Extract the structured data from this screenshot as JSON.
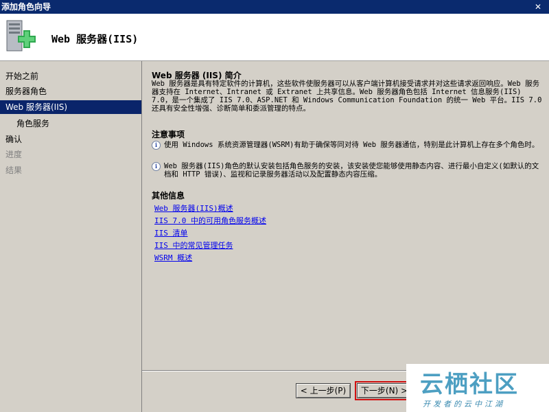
{
  "window": {
    "title": "添加角色向导",
    "close_symbol": "✕"
  },
  "header": {
    "title": "Web 服务器(IIS)",
    "icon": "server-add-icon"
  },
  "nav": {
    "items": [
      {
        "label": "开始之前"
      },
      {
        "label": "服务器角色"
      },
      {
        "label": "Web 服务器(IIS)"
      },
      {
        "label": "角色服务"
      },
      {
        "label": "确认"
      },
      {
        "label": "进度"
      },
      {
        "label": "结果"
      }
    ]
  },
  "content": {
    "intro_heading": "Web 服务器 (IIS) 简介",
    "intro_text": "Web 服务器是具有特定软件的计算机，这些软件使服务器可以从客户端计算机接受请求并对这些请求返回响应。Web 服务器支持在 Internet、Intranet 或 Extranet 上共享信息。Web 服务器角色包括 Internet 信息服务(IIS) 7.0，是一个集成了 IIS 7.0、ASP.NET 和 Windows Communication Foundation 的统一 Web 平台。IIS 7.0 还具有安全性增强、诊断简单和委派管理的特点。",
    "notes_heading": "注意事项",
    "notes": [
      "使用 Windows 系统资源管理器(WSRM)有助于确保等同对待 Web 服务器通信，特别是此计算机上存在多个角色时。",
      "Web 服务器(IIS)角色的默认安装包括角色服务的安装，该安装使您能够使用静态内容、进行最小自定义(如默认的文档和 HTTP 错误)、监视和记录服务器活动以及配置静态内容压缩。"
    ],
    "more_heading": "其他信息",
    "links": [
      "Web 服务器(IIS)概述",
      "IIS 7.0 中的可用角色服务概述",
      "IIS 清单",
      "IIS 中的常见管理任务",
      "WSRM 概述"
    ]
  },
  "buttons": {
    "back": "< 上一步(P)",
    "next": "下一步(N) >"
  },
  "watermark": {
    "brand": "云栖社区",
    "tagline": "开发者的云中江湖"
  }
}
